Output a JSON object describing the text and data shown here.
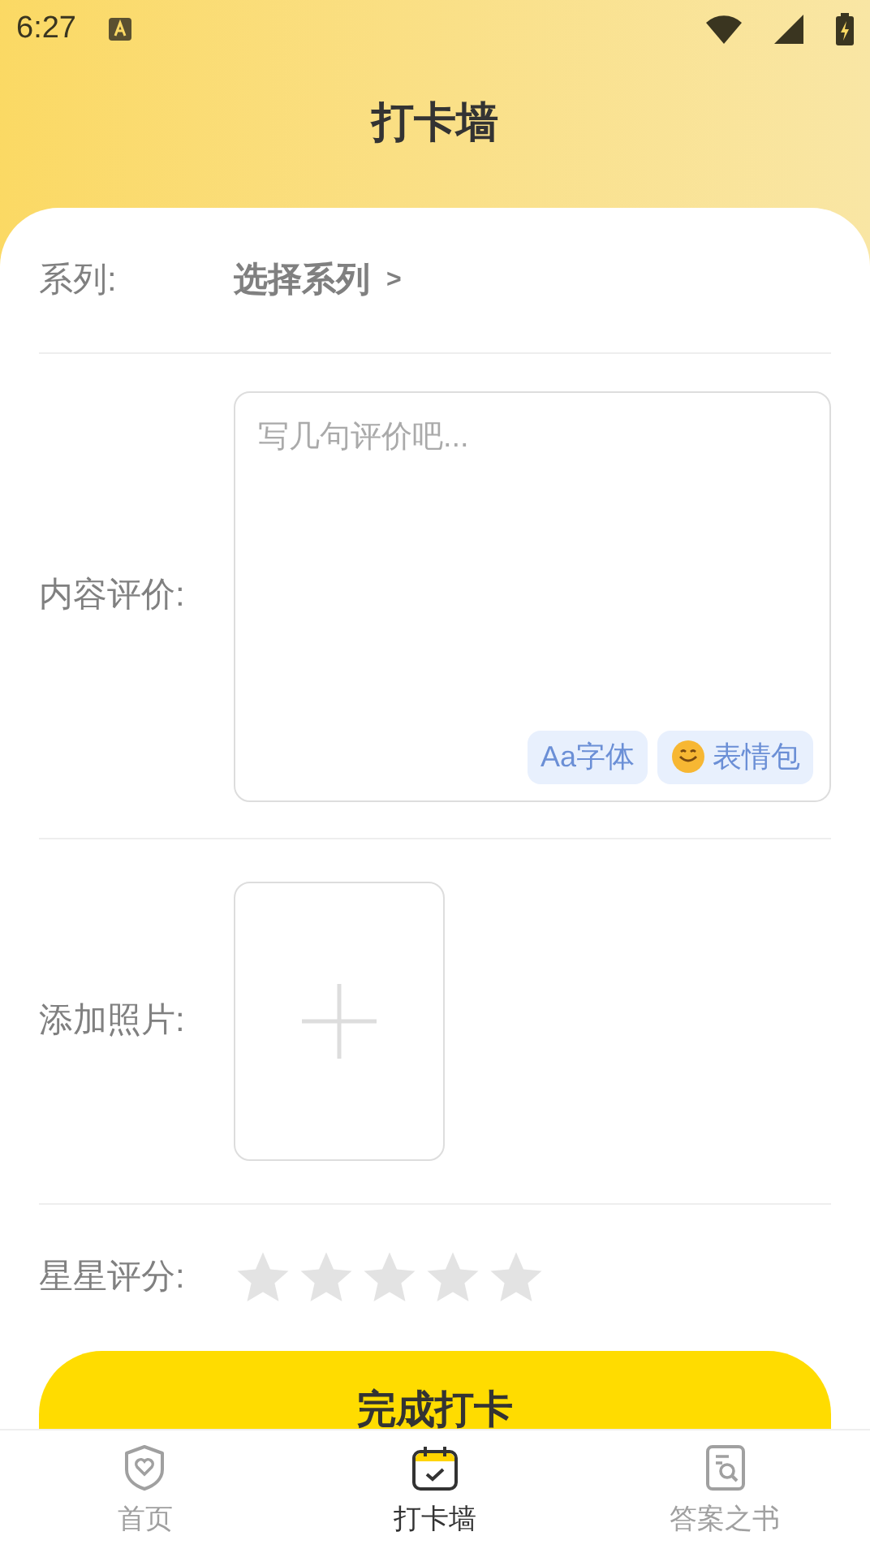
{
  "status_bar": {
    "time": "6:27"
  },
  "header": {
    "title": "打卡墙"
  },
  "series": {
    "label": "系列:",
    "value": "选择系列",
    "chevron": ">"
  },
  "review": {
    "label": "内容评价:",
    "placeholder": "写几句评价吧...",
    "tools": [
      {
        "label": "Aa字体",
        "kind": "font"
      },
      {
        "label": "表情包",
        "kind": "emoji"
      }
    ]
  },
  "photo": {
    "label": "添加照片:"
  },
  "rating": {
    "label": "星星评分:",
    "stars": 0
  },
  "submit": {
    "label": "完成打卡"
  },
  "tabs": [
    {
      "label": "首页",
      "kind": "home",
      "selected": false
    },
    {
      "label": "打卡墙",
      "kind": "calendar",
      "selected": true
    },
    {
      "label": "答案之书",
      "kind": "book",
      "selected": false
    }
  ]
}
